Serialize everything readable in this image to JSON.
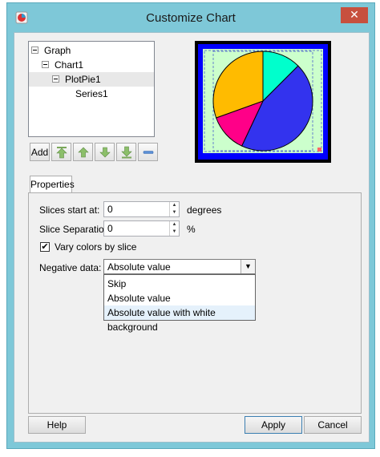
{
  "window": {
    "title": "Customize Chart",
    "close_glyph": "✕"
  },
  "tree": {
    "items": [
      {
        "label": "Graph"
      },
      {
        "label": "Chart1"
      },
      {
        "label": "PlotPie1"
      },
      {
        "label": "Series1"
      }
    ]
  },
  "toolbar": {
    "add_label": "Add",
    "icons": [
      "move-top-icon",
      "move-up-icon",
      "move-down-icon",
      "move-bottom-icon",
      "remove-icon"
    ]
  },
  "preview": {
    "slices": [
      {
        "color": "#00ffcc",
        "value": 0.125
      },
      {
        "color": "#3333ee",
        "value": 0.445
      },
      {
        "color": "#ff0088",
        "value": 0.125
      },
      {
        "color": "#ffbb00",
        "value": 0.305
      }
    ],
    "background_color": "#ccffcc",
    "frame_color": "#0000ff"
  },
  "tabs": [
    {
      "label": "Properties"
    }
  ],
  "properties": {
    "slices_start_label": "Slices start at:",
    "slices_start_value": "0",
    "slices_start_unit": "degrees",
    "slice_sep_label": "Slice Separation:",
    "slice_sep_value": "0",
    "slice_sep_unit": "%",
    "vary_colors_label": "Vary colors by slice",
    "vary_colors_checked": "✔",
    "negative_label": "Negative data:",
    "negative_value": "Absolute value",
    "negative_options": [
      "Skip",
      "Absolute value",
      "Absolute value with white background"
    ]
  },
  "footer": {
    "help": "Help",
    "apply": "Apply",
    "cancel": "Cancel"
  }
}
